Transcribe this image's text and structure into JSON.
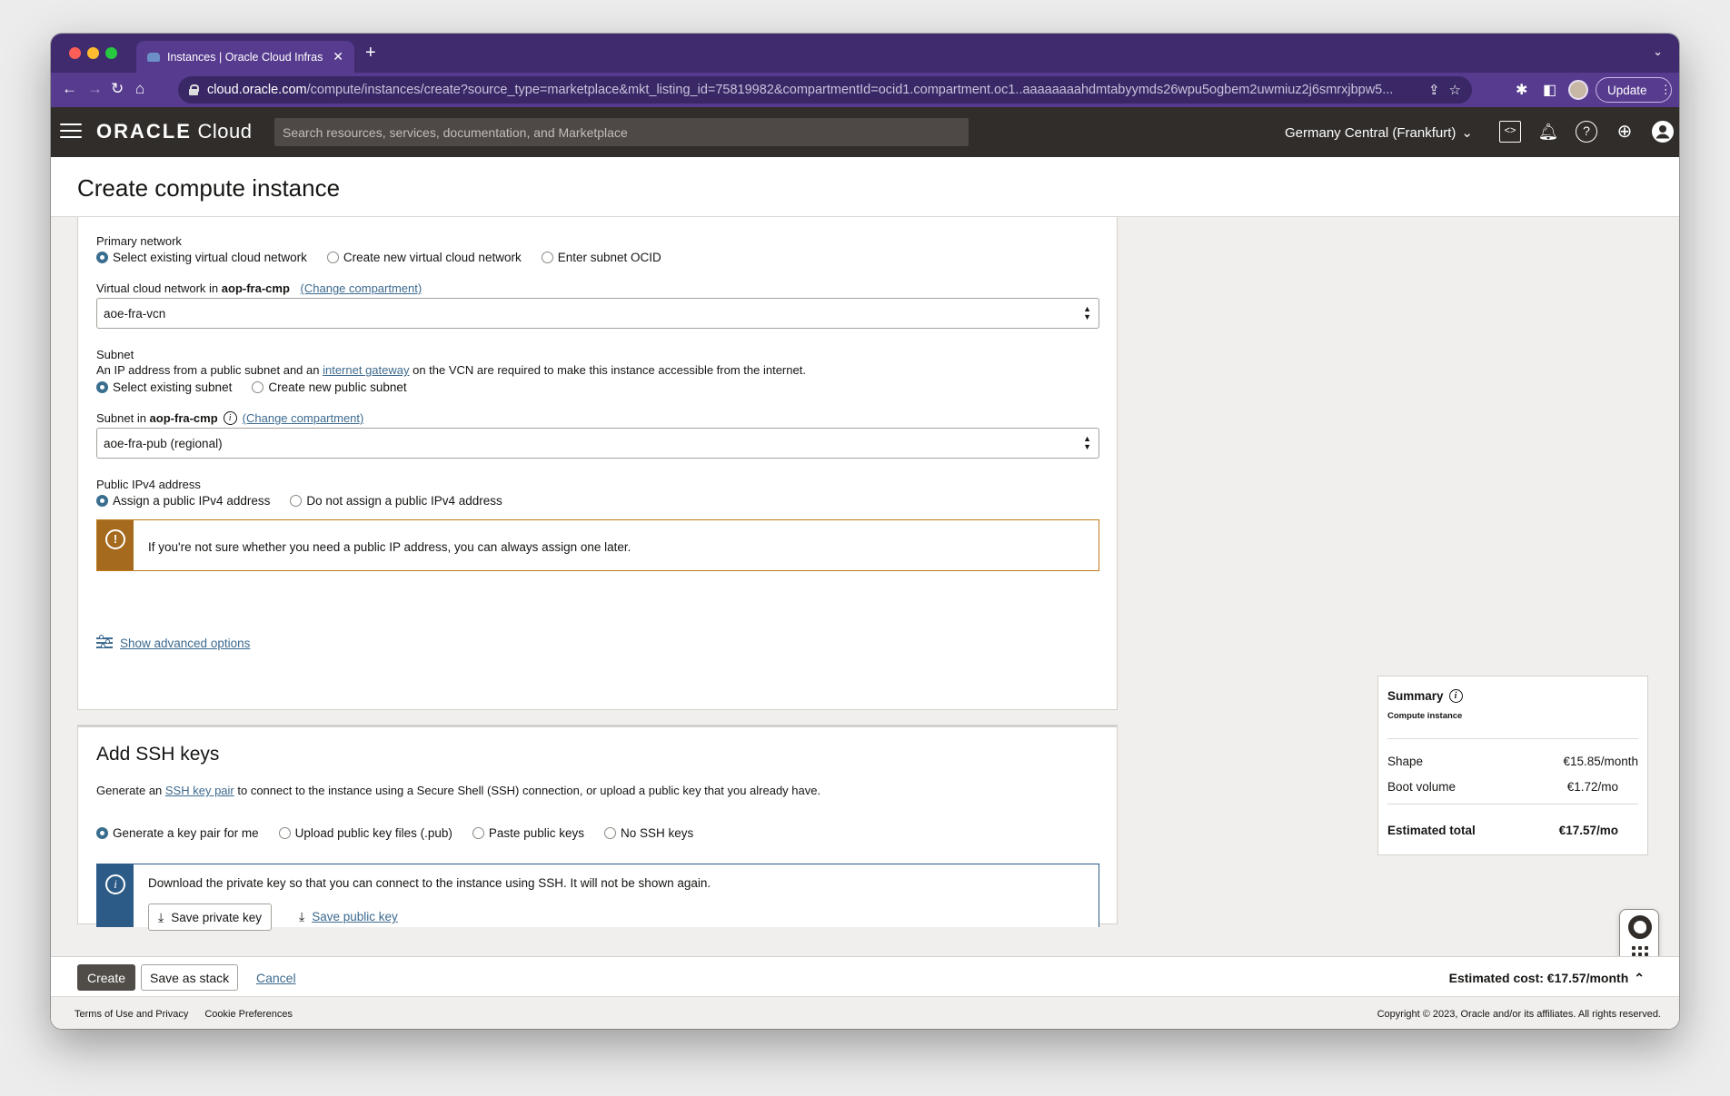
{
  "browser": {
    "tab_title": "Instances | Oracle Cloud Infras",
    "new_tab": "+",
    "url_host": "cloud.oracle.com",
    "url_path": "/compute/instances/create?source_type=marketplace&mkt_listing_id=75819982&compartmentId=ocid1.compartment.oc1..aaaaaaaahdmtabyymds26wpu5ogbem2uwmiuz2j6smrxjbpw5...",
    "update_label": "Update"
  },
  "header": {
    "logo_bold": "ORACLE",
    "logo_light": "Cloud",
    "search_placeholder": "Search resources, services, documentation, and Marketplace",
    "region": "Germany Central (Frankfurt)"
  },
  "page": {
    "title": "Create compute instance"
  },
  "network": {
    "primary_label": "Primary network",
    "primary_options": [
      "Select existing virtual cloud network",
      "Create new virtual cloud network",
      "Enter subnet OCID"
    ],
    "vcn_label_prefix": "Virtual cloud network in ",
    "vcn_compartment": "aop-fra-cmp",
    "change_compartment": "(Change compartment)",
    "vcn_value": "aoe-fra-vcn",
    "subnet_label": "Subnet",
    "subnet_desc_pre": "An IP address from a public subnet and an ",
    "subnet_desc_link": "internet gateway",
    "subnet_desc_post": " on the VCN are required to make this instance accessible from the internet.",
    "subnet_options": [
      "Select existing subnet",
      "Create new public subnet"
    ],
    "subnet_in_prefix": "Subnet in ",
    "subnet_compartment": "aop-fra-cmp",
    "subnet_value": "aoe-fra-pub (regional)",
    "ipv4_label": "Public IPv4 address",
    "ipv4_options": [
      "Assign a public IPv4 address",
      "Do not assign a public IPv4 address"
    ],
    "ipv4_alert": "If you're not sure whether you need a public IP address, you can always assign one later.",
    "advanced_link": "Show advanced options"
  },
  "ssh": {
    "title": "Add SSH keys",
    "desc_pre": "Generate an ",
    "desc_link": "SSH key pair",
    "desc_post": " to connect to the instance using a Secure Shell (SSH) connection, or upload a public key that you already have.",
    "options": [
      "Generate a key pair for me",
      "Upload public key files (.pub)",
      "Paste public keys",
      "No SSH keys"
    ],
    "info": "Download the private key so that you can connect to the instance using SSH. It will not be shown again.",
    "save_private": "Save private key",
    "save_public": "Save public key"
  },
  "summary": {
    "title": "Summary",
    "subtitle": "Compute instance",
    "rows": [
      {
        "label": "Shape",
        "value": "€15.85/month"
      },
      {
        "label": "Boot volume",
        "value": "€1.72/mo"
      }
    ],
    "total_label": "Estimated total",
    "total_value": "€17.57/mo"
  },
  "actions": {
    "create": "Create",
    "save_stack": "Save as stack",
    "cancel": "Cancel",
    "estimated_cost": "Estimated cost: €17.57/month"
  },
  "footer": {
    "terms": "Terms of Use and Privacy",
    "cookies": "Cookie Preferences",
    "copyright": "Copyright © 2023, Oracle and/or its affiliates. All rights reserved."
  },
  "colors": {
    "chrome_purple": "#563b8f",
    "oracle_header": "#312d2a",
    "radio_selected": "#3a6e8f",
    "warning": "#a56a1e",
    "info": "#2c5b87",
    "link": "#3d6a8f"
  }
}
